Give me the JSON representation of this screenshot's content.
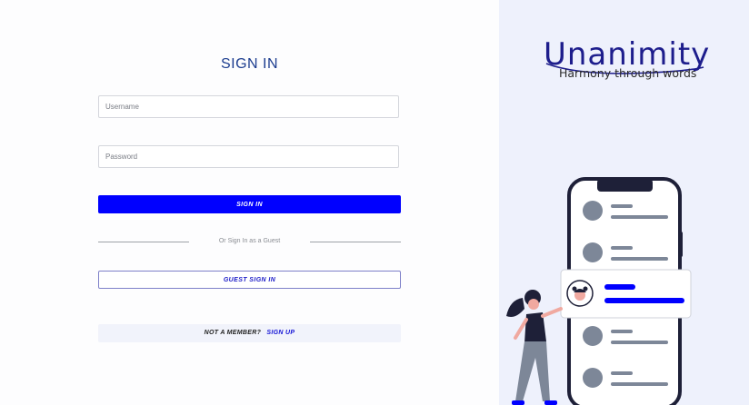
{
  "login": {
    "title": "SIGN IN",
    "username_placeholder": "Username",
    "password_placeholder": "Password",
    "signin_label": "SIGN IN",
    "divider_text": "Or Sign In as a Guest",
    "guest_label": "GUEST SIGN IN",
    "not_member_text": "NOT A MEMBER?",
    "signup_label": "SIGN UP"
  },
  "brand": {
    "name": "Unanimity",
    "tagline": "Harmony through words"
  },
  "colors": {
    "primary_button": "#0000ff",
    "title": "#1c3d8f",
    "right_panel": "#eef1fc",
    "brand": "#1d1d8c"
  },
  "illustration": {
    "icon": "phone-chat-illustration"
  }
}
